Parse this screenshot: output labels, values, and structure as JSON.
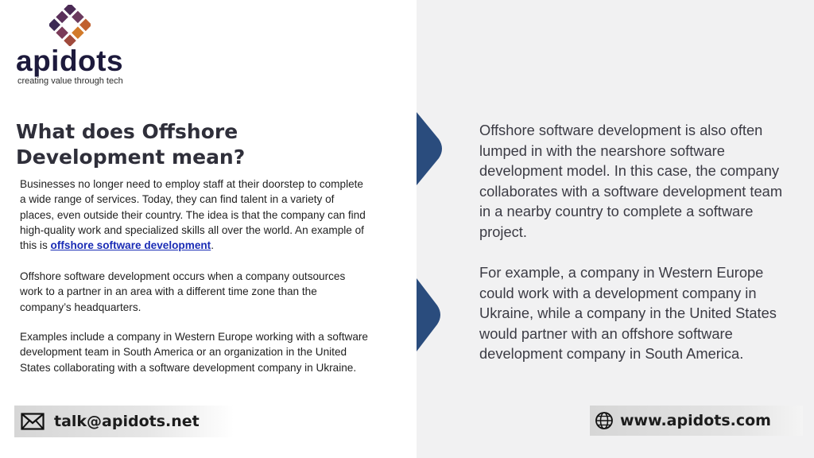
{
  "brand": {
    "wordmark": "apidots",
    "tagline": "creating value through tech",
    "colors": {
      "navy": "#1d1a3c",
      "purple": "#4b2a55",
      "orange": "#f08a24",
      "arrow": "#2a4c7d"
    }
  },
  "left": {
    "heading": "What does Offshore Development mean?",
    "p1_text": "Businesses no longer need to employ staff at their doorstep to complete a wide range of services. Today, they can find talent in a variety of places, even outside their country. The idea is that the company can find high-quality work and specialized skills all over the world. An example of this is ",
    "p1_link": "offshore software development",
    "p1_end": ".",
    "p2": "Offshore software development occurs when a company outsources work to a partner in an area with a different time zone than the company’s headquarters.",
    "p3": "Examples include a company in Western Europe working with a software development team in South America or an organization in the United States collaborating with a software development company in Ukraine."
  },
  "right": {
    "p1": "Offshore software development is also often lumped in with the nearshore software development model. In this case, the company collaborates with a software development team in a nearby country to complete a software project.",
    "p2": "For example, a company in Western Europe could work with a development company in Ukraine, while a company in the United States would partner with an offshore software development company in South America."
  },
  "contact": {
    "email": "talk@apidots.net",
    "email_icon": "envelope-icon",
    "website": "www.apidots.com",
    "website_icon": "globe-icon"
  }
}
